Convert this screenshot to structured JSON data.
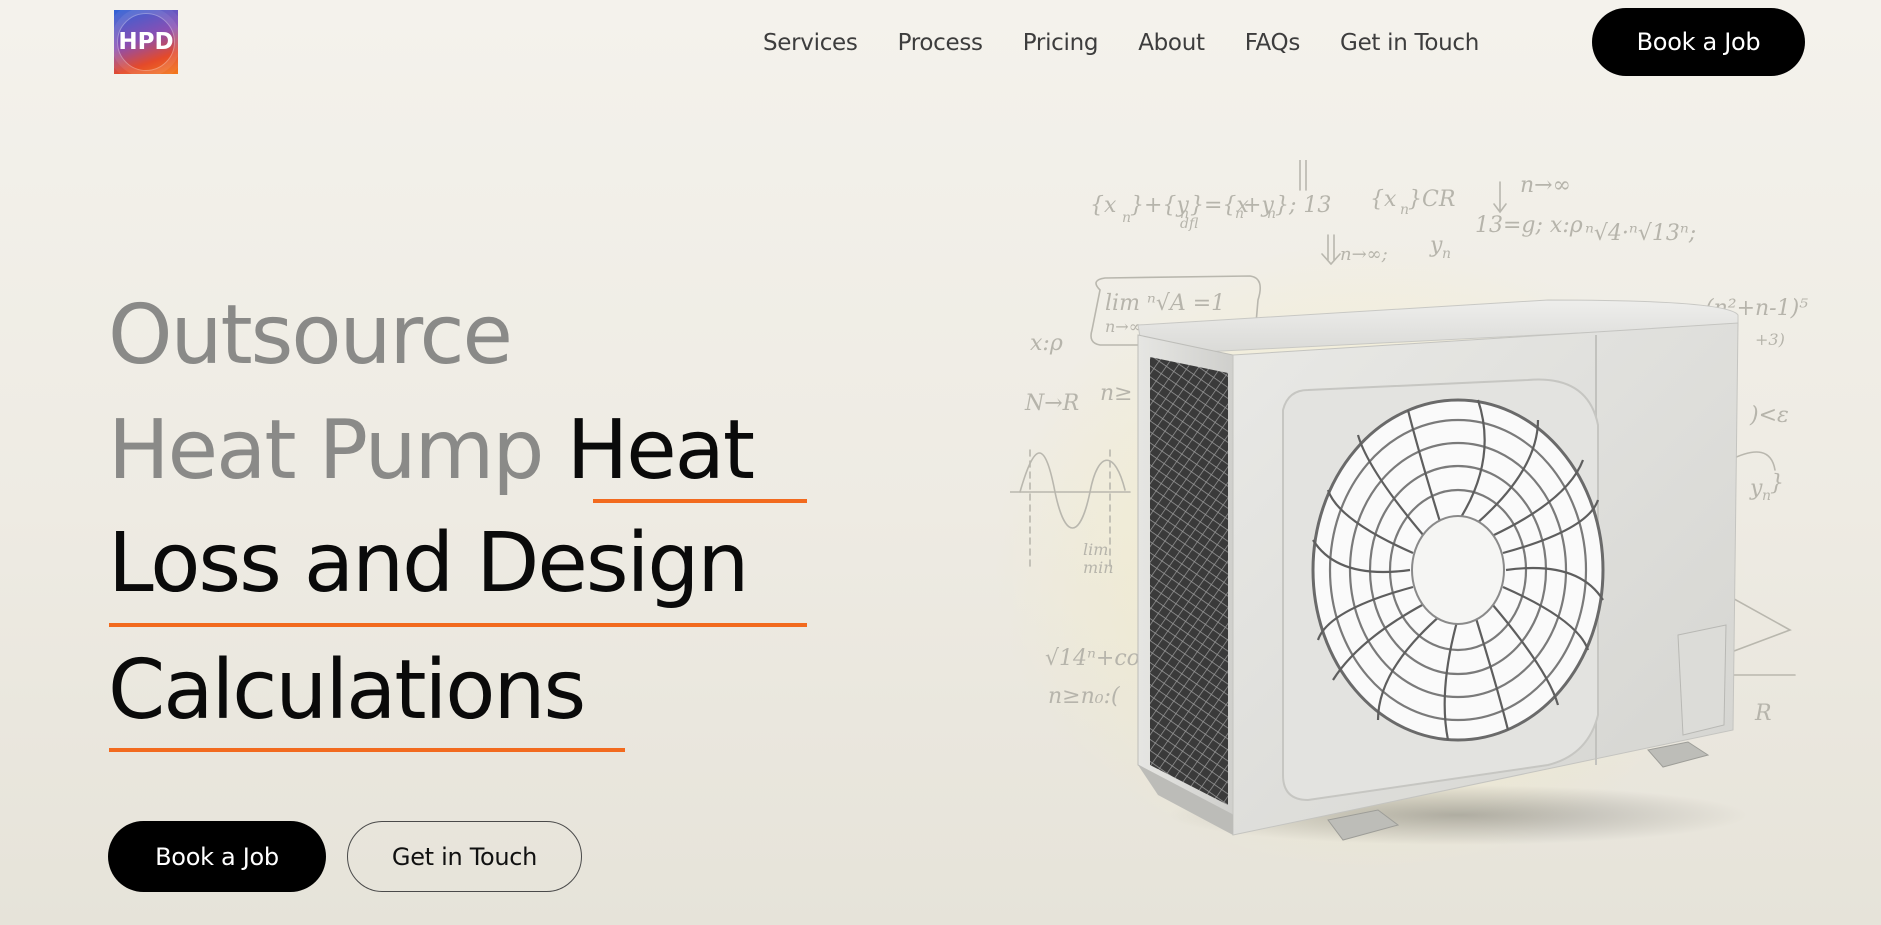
{
  "header": {
    "logo_text": "HPD",
    "nav": [
      "Services",
      "Process",
      "Pricing",
      "About",
      "FAQs",
      "Get in Touch"
    ],
    "cta_label": "Book a Job"
  },
  "hero": {
    "line1": "Outsource",
    "line2_muted": "Heat Pump",
    "line2_strong": "Heat",
    "line3": "Loss and Design",
    "line4": "Calculations",
    "primary_cta": "Book a Job",
    "secondary_cta": "Get in Touch"
  },
  "colors": {
    "accent_underline": "#f26a1e",
    "muted_text": "#8a8a88",
    "button_dark": "#000000"
  }
}
